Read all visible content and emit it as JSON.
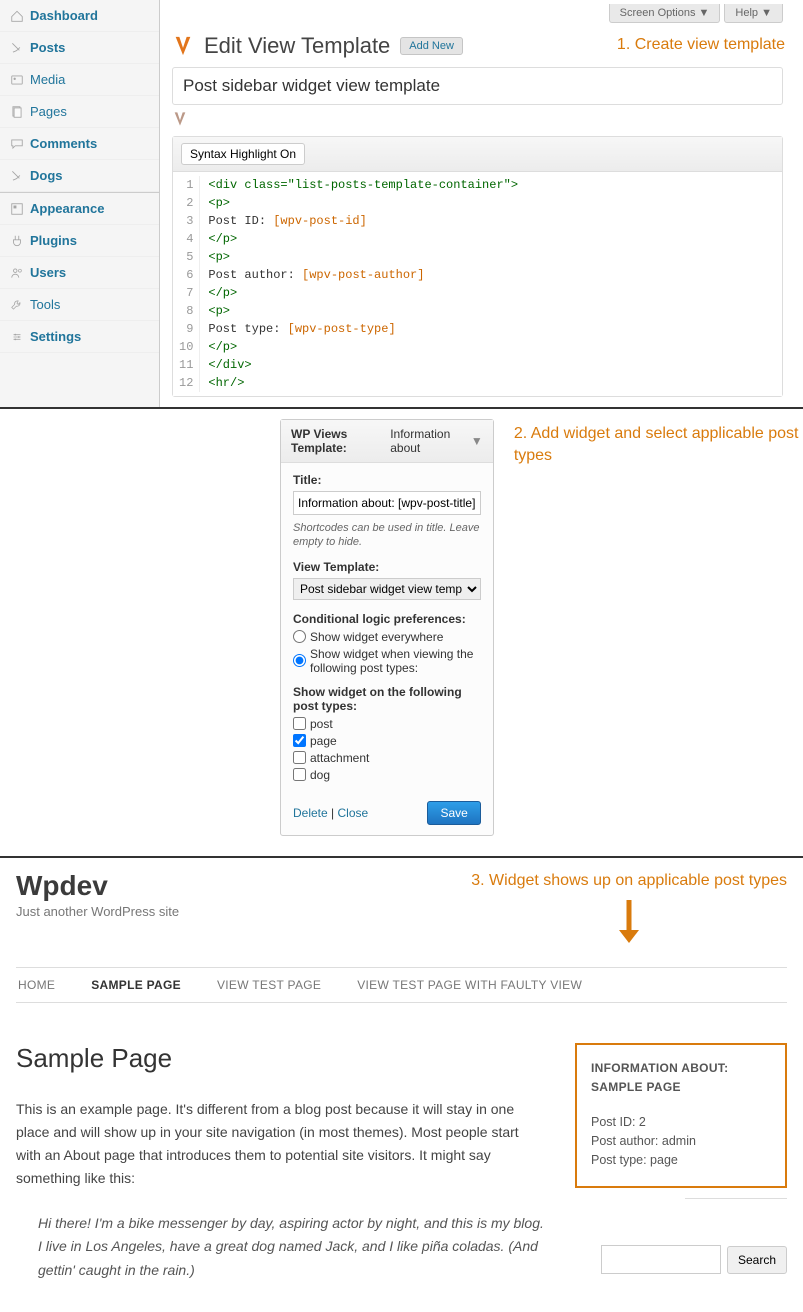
{
  "topTabs": {
    "screenOptions": "Screen Options ▼",
    "help": "Help ▼"
  },
  "sidebar": {
    "items": [
      {
        "name": "dashboard",
        "label": "Dashboard",
        "bold": true
      },
      {
        "name": "posts",
        "label": "Posts",
        "bold": true
      },
      {
        "name": "media",
        "label": "Media",
        "bold": false
      },
      {
        "name": "pages",
        "label": "Pages",
        "bold": false
      },
      {
        "name": "comments",
        "label": "Comments",
        "bold": true
      },
      {
        "name": "dogs",
        "label": "Dogs",
        "bold": true
      },
      {
        "name": "appearance",
        "label": "Appearance",
        "bold": true
      },
      {
        "name": "plugins",
        "label": "Plugins",
        "bold": true
      },
      {
        "name": "users",
        "label": "Users",
        "bold": true
      },
      {
        "name": "tools",
        "label": "Tools",
        "bold": false
      },
      {
        "name": "settings",
        "label": "Settings",
        "bold": true
      }
    ]
  },
  "heading": {
    "title": "Edit View Template",
    "addNew": "Add New"
  },
  "templateTitle": "Post sidebar widget view template",
  "syntaxBtn": "Syntax Highlight On",
  "code": {
    "lines": [
      "1",
      "2",
      "3",
      "4",
      "5",
      "6",
      "7",
      "8",
      "9",
      "10",
      "11",
      "12"
    ],
    "tokens": [
      [
        {
          "t": "tag",
          "v": "<div class=\"list-posts-template-container\">"
        }
      ],
      [
        {
          "t": "plain",
          "v": "  "
        },
        {
          "t": "tag",
          "v": "<p>"
        }
      ],
      [
        {
          "t": "plain",
          "v": "    Post ID: "
        },
        {
          "t": "sc",
          "v": "[wpv-post-id]"
        }
      ],
      [
        {
          "t": "plain",
          "v": "  "
        },
        {
          "t": "tag",
          "v": "</p>"
        }
      ],
      [
        {
          "t": "plain",
          "v": "  "
        },
        {
          "t": "tag",
          "v": "<p>"
        }
      ],
      [
        {
          "t": "plain",
          "v": "    Post author: "
        },
        {
          "t": "sc",
          "v": "[wpv-post-author]"
        }
      ],
      [
        {
          "t": "plain",
          "v": "  "
        },
        {
          "t": "tag",
          "v": "</p>"
        }
      ],
      [
        {
          "t": "plain",
          "v": "  "
        },
        {
          "t": "tag",
          "v": "<p>"
        }
      ],
      [
        {
          "t": "plain",
          "v": "    Post type: "
        },
        {
          "t": "sc",
          "v": "[wpv-post-type]"
        }
      ],
      [
        {
          "t": "plain",
          "v": "  "
        },
        {
          "t": "tag",
          "v": "</p>"
        }
      ],
      [
        {
          "t": "tag",
          "v": "</div>"
        }
      ],
      [
        {
          "t": "tag",
          "v": "<hr/>"
        }
      ]
    ]
  },
  "annot1": "1. Create view template",
  "widget": {
    "headerPrefix": "WP Views Template: ",
    "headerTitle": "Information about",
    "titleLabel": "Title:",
    "titleValue": "Information about: [wpv-post-title]",
    "hint": "Shortcodes can be used in title. Leave empty to hide.",
    "vtLabel": "View Template:",
    "vtValue": "Post sidebar widget view template",
    "condLabel": "Conditional logic preferences:",
    "radio1": "Show widget everywhere",
    "radio2": "Show widget when viewing the following post types:",
    "ptLabel": "Show widget on the following post types:",
    "checks": [
      {
        "label": "post",
        "checked": false
      },
      {
        "label": "page",
        "checked": true
      },
      {
        "label": "attachment",
        "checked": false
      },
      {
        "label": "dog",
        "checked": false
      }
    ],
    "delete": "Delete",
    "close": "Close",
    "save": "Save"
  },
  "annot2": "2. Add widget and select applicable post types",
  "front": {
    "siteTitle": "Wpdev",
    "tagline": "Just another WordPress site",
    "menu": [
      {
        "label": "HOME",
        "active": false
      },
      {
        "label": "SAMPLE PAGE",
        "active": true
      },
      {
        "label": "VIEW TEST PAGE",
        "active": false
      },
      {
        "label": "VIEW TEST PAGE WITH FAULTY VIEW",
        "active": false
      }
    ],
    "pageTitle": "Sample Page",
    "para1": "This is an example page. It's different from a blog post because it will stay in one place and will show up in your site navigation (in most themes). Most people start with an About page that introduces them to potential site visitors. It might say something like this:",
    "quote": "Hi there! I'm a bike messenger by day, aspiring actor by night, and this is my blog. I live in Los Angeles, have a great dog named Jack, and I like piña coladas. (And gettin' caught in the rain.)",
    "info": {
      "heading": "INFORMATION ABOUT: SAMPLE PAGE",
      "l1": "Post ID: 2",
      "l2": "Post author: admin",
      "l3": "Post type: page"
    },
    "searchBtn": "Search"
  },
  "annot3": "3. Widget shows up on applicable post types"
}
